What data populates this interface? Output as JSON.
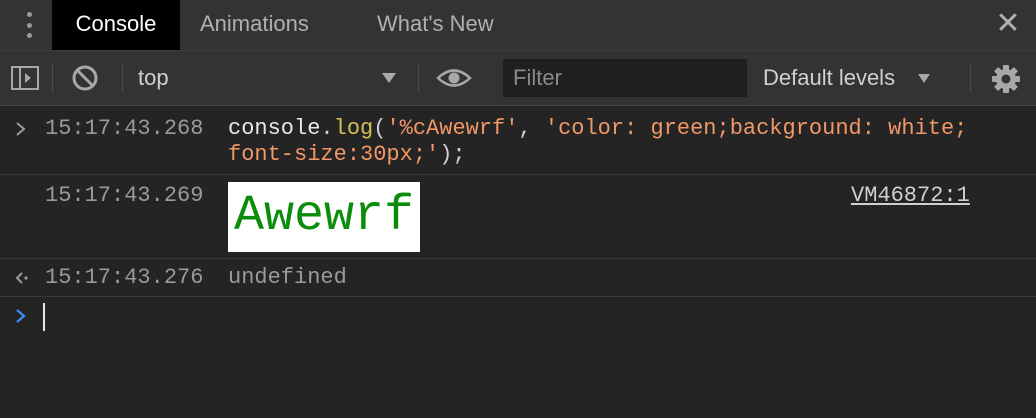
{
  "tabs": [
    {
      "label": "Console",
      "active": true
    },
    {
      "label": "Animations",
      "active": false
    },
    {
      "label": "What's New",
      "active": false
    }
  ],
  "toolbar": {
    "context": "top",
    "filter_placeholder": "Filter",
    "levels_label": "Default levels"
  },
  "console": {
    "entries": [
      {
        "timestamp": "15:17:43.268",
        "code": {
          "obj": "console",
          "dot": ".",
          "fn": "log",
          "open": "(",
          "arg1": "'%cAwewrf'",
          "comma": ", ",
          "arg2": "'color: green;background: white; font-size:30px;'",
          "close": ");"
        }
      },
      {
        "timestamp": "15:17:43.269",
        "output": "Awewrf",
        "source": "VM46872:1"
      },
      {
        "timestamp": "15:17:43.276",
        "result": "undefined"
      }
    ]
  },
  "colors": {
    "string": "#f29766",
    "function": "#d2c057",
    "prompt": "#3d8cf0",
    "styled_text": "#0b8c0b"
  }
}
